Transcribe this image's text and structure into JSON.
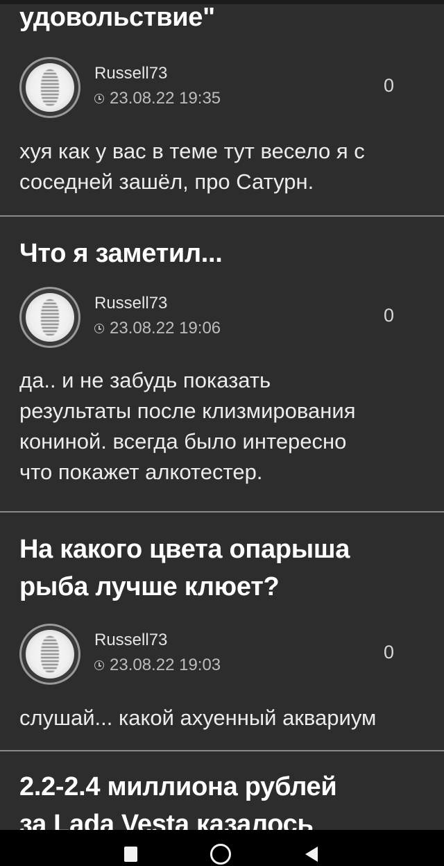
{
  "posts": [
    {
      "title_lines": [
        "удовольствие\""
      ],
      "comment": {
        "author": "Russell73",
        "time": "23.08.22 19:35",
        "rating": "0",
        "text_lines": [
          "хуя как у вас в теме тут весело я с",
          "соседней зашёл, про Сатурн."
        ]
      }
    },
    {
      "title_lines": [
        "Что я заметил..."
      ],
      "comment": {
        "author": "Russell73",
        "time": "23.08.22 19:06",
        "rating": "0",
        "text_lines": [
          "да.. и не забудь показать",
          "результаты после клизмирования",
          "кониной. всегда было интересно",
          "что покажет алкотестер."
        ]
      }
    },
    {
      "title_lines": [
        "На какого цвета опарыша",
        "рыба лучше клюет?"
      ],
      "comment": {
        "author": "Russell73",
        "time": "23.08.22 19:03",
        "rating": "0",
        "text_lines": [
          "слушай... какой ахуенный аквариум"
        ]
      }
    },
    {
      "title_lines": [
        "2.2-2.4 миллиона рублей",
        "за Lada Vesta казалось"
      ]
    }
  ],
  "icons": {
    "clock": "clock-icon",
    "nav_recent": "square-icon",
    "nav_home": "circle-icon",
    "nav_back": "triangle-back-icon"
  },
  "colors": {
    "background": "#2d2d2d",
    "divider": "#8a8a8a",
    "text": "#ececec",
    "nav_bar": "#000000"
  }
}
